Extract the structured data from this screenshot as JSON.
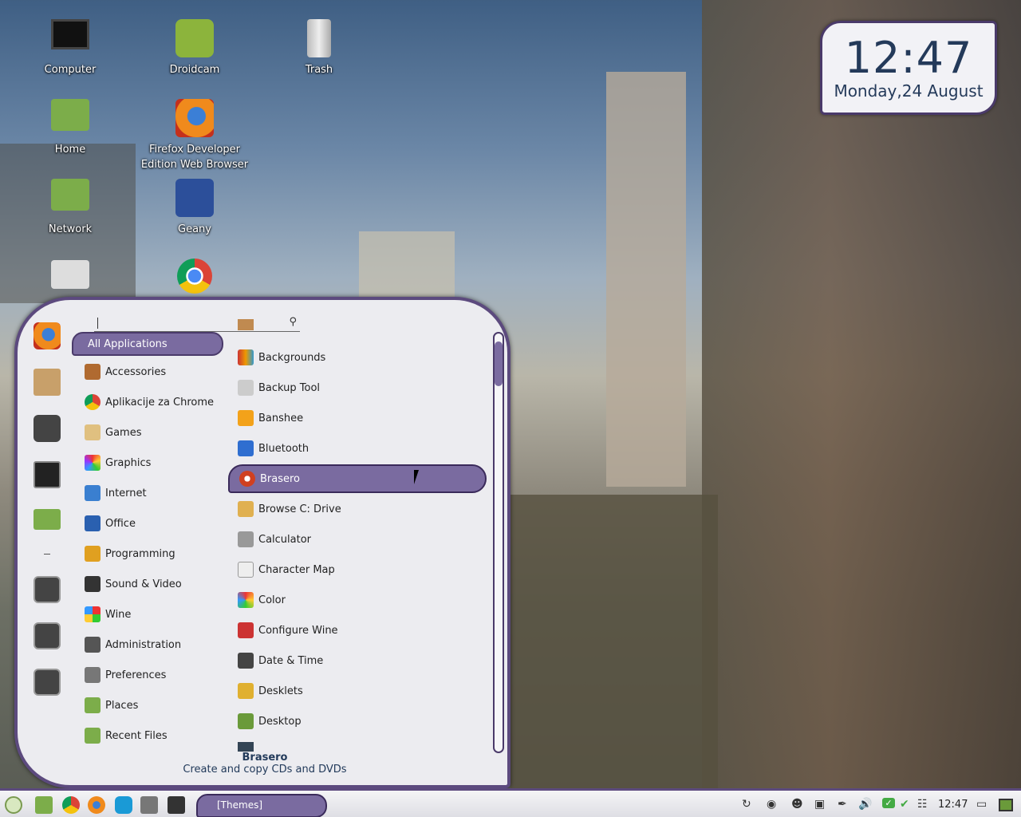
{
  "desktop": {
    "icons": [
      {
        "label": "Computer"
      },
      {
        "label": "Droidcam"
      },
      {
        "label": "Trash"
      },
      {
        "label": "Home"
      },
      {
        "label": "Firefox Developer Edition Web Browser"
      },
      {
        "label": "Network"
      },
      {
        "label": "Geany"
      }
    ]
  },
  "clock": {
    "time": "12:47",
    "date": "Monday,24 August"
  },
  "menu": {
    "search": {
      "value": "",
      "placeholder": ""
    },
    "categories": [
      {
        "label": "All Applications"
      },
      {
        "label": "Accessories"
      },
      {
        "label": "Aplikacije za Chrome"
      },
      {
        "label": "Games"
      },
      {
        "label": "Graphics"
      },
      {
        "label": "Internet"
      },
      {
        "label": "Office"
      },
      {
        "label": "Programming"
      },
      {
        "label": "Sound & Video"
      },
      {
        "label": "Wine"
      },
      {
        "label": "Administration"
      },
      {
        "label": "Preferences"
      },
      {
        "label": "Places"
      },
      {
        "label": "Recent Files"
      }
    ],
    "apps": [
      {
        "label": "Backgrounds"
      },
      {
        "label": "Backup Tool"
      },
      {
        "label": "Banshee"
      },
      {
        "label": "Bluetooth"
      },
      {
        "label": "Brasero"
      },
      {
        "label": "Browse C: Drive"
      },
      {
        "label": "Calculator"
      },
      {
        "label": "Character Map"
      },
      {
        "label": "Color"
      },
      {
        "label": "Configure Wine"
      },
      {
        "label": "Date & Time"
      },
      {
        "label": "Desklets"
      },
      {
        "label": "Desktop"
      }
    ],
    "description": {
      "title": "Brasero",
      "text": "Create and copy CDs and DVDs"
    }
  },
  "panel": {
    "window_button": "[Themes]",
    "time": "12:47"
  },
  "colors": {
    "accent": "#7a6ba0",
    "border": "#4a3a6a",
    "menu_bg": "#ececf0"
  }
}
